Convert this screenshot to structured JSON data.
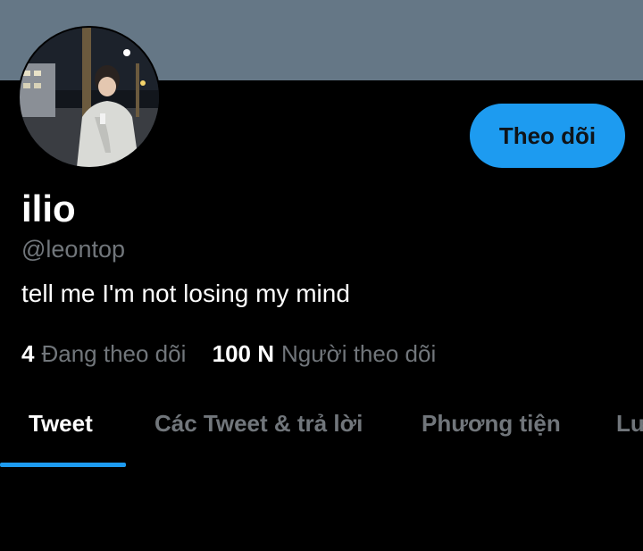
{
  "colors": {
    "banner": "#657786",
    "accent": "#1d9bf0",
    "secondary_text": "#71767b",
    "tab_inactive": "#71767b"
  },
  "profile": {
    "display_name": "ilio",
    "handle": "@leontop",
    "bio": "tell me I'm not losing my mind",
    "follow_label": "Theo dõi",
    "following_count": "4",
    "following_label": "Đang theo dõi",
    "followers_count": "100 N",
    "followers_label": "Người theo dõi"
  },
  "tabs": [
    {
      "label": "Tweet",
      "active": true
    },
    {
      "label": "Các Tweet & trả lời",
      "active": false
    },
    {
      "label": "Phương tiện",
      "active": false
    },
    {
      "label": "Lượt thích",
      "active": false
    }
  ]
}
